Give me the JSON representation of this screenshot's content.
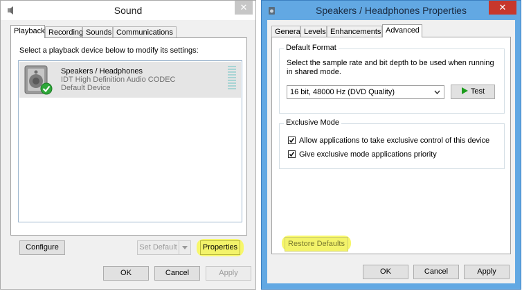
{
  "sound_window": {
    "title": "Sound",
    "close_glyph": "✕",
    "tabs": [
      {
        "label": "Playback",
        "active": true
      },
      {
        "label": "Recording",
        "active": false
      },
      {
        "label": "Sounds",
        "active": false
      },
      {
        "label": "Communications",
        "active": false
      }
    ],
    "instruction": "Select a playback device below to modify its settings:",
    "device": {
      "name": "Speakers / Headphones",
      "driver": "IDT High Definition Audio CODEC",
      "status": "Default Device",
      "icon": "speaker-icon",
      "badge_icon": "default-check-icon"
    },
    "buttons": {
      "configure": "Configure",
      "set_default": "Set Default",
      "properties": "Properties",
      "ok": "OK",
      "cancel": "Cancel",
      "apply": "Apply"
    }
  },
  "props_window": {
    "title": "Speakers / Headphones Properties",
    "close_glyph": "✕",
    "tabs": [
      {
        "label": "General",
        "active": false
      },
      {
        "label": "Levels",
        "active": false
      },
      {
        "label": "Enhancements",
        "active": false
      },
      {
        "label": "Advanced",
        "active": true
      }
    ],
    "default_format": {
      "title": "Default Format",
      "description": "Select the sample rate and bit depth to be used when running in shared mode.",
      "selected": "16 bit, 48000 Hz (DVD Quality)",
      "test_label": "Test"
    },
    "exclusive_mode": {
      "title": "Exclusive Mode",
      "options": [
        {
          "label": "Allow applications to take exclusive control of this device",
          "checked": true
        },
        {
          "label": "Give exclusive mode applications priority",
          "checked": true
        }
      ]
    },
    "buttons": {
      "restore_defaults": "Restore Defaults",
      "ok": "OK",
      "cancel": "Cancel",
      "apply": "Apply"
    }
  },
  "colors": {
    "highlight": "#f7f76b",
    "props_frame": "#62a8e3",
    "close_red": "#c7372c",
    "check_green": "#2fa83a",
    "play_green": "#1c9c1c"
  }
}
